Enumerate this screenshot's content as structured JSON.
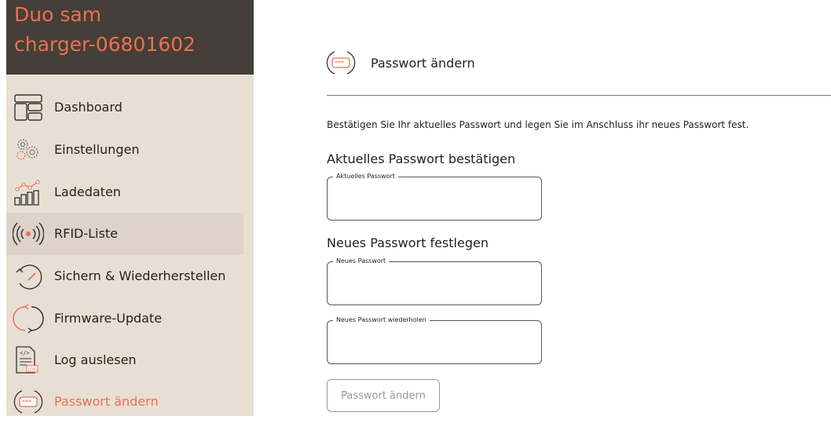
{
  "brand": {
    "line1": "Duo sam",
    "line2": "charger-06801602"
  },
  "sidebar": {
    "items": [
      {
        "label": "Dashboard",
        "icon": "dashboard-icon"
      },
      {
        "label": "Einstellungen",
        "icon": "gears-icon"
      },
      {
        "label": "Ladedaten",
        "icon": "chart-icon"
      },
      {
        "label": "RFID-Liste",
        "icon": "rfid-icon"
      },
      {
        "label": "Sichern & Wiederherstellen",
        "icon": "backup-restore-icon"
      },
      {
        "label": "Firmware-Update",
        "icon": "refresh-icon"
      },
      {
        "label": "Log auslesen",
        "icon": "log-file-icon"
      },
      {
        "label": "Passwort ändern",
        "icon": "password-icon"
      }
    ]
  },
  "main": {
    "title": "Passwort ändern",
    "intro": "Bestätigen Sie Ihr aktuelles Passwort und legen Sie im Anschluss ihr neues Passwort fest.",
    "section_current": "Aktuelles Passwort bestätigen",
    "field_current_label": "Aktuelles Passwort",
    "section_new": "Neues Passwort festlegen",
    "field_new_label": "Neues Passwort",
    "field_repeat_label": "Neues Passwort wiederholen",
    "submit_label": "Passwort ändern"
  },
  "colors": {
    "accent": "#e8714f",
    "brand_bg": "#453e39",
    "sidebar_bg": "#e8dfd4"
  }
}
